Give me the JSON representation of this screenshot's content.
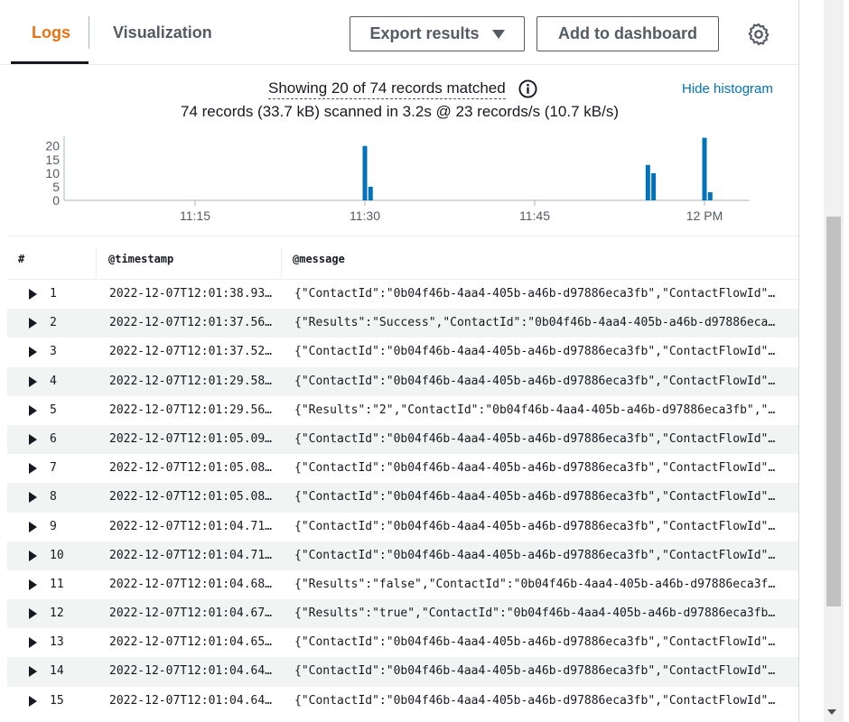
{
  "tabs": {
    "logs": "Logs",
    "visualization": "Visualization"
  },
  "toolbar": {
    "export_label": "Export results",
    "dashboard_label": "Add to dashboard"
  },
  "summary": {
    "matched": "Showing 20 of 74 records matched",
    "scanned": "74 records (33.7 kB) scanned in 3.2s @ 23 records/s (10.7 kB/s)",
    "hide_histogram": "Hide histogram"
  },
  "chart_data": {
    "type": "bar",
    "x_tick_labels": [
      "11:15",
      "11:30",
      "11:45",
      "12 PM"
    ],
    "y_tick_labels": [
      "20",
      "15",
      "10",
      "5",
      "0"
    ],
    "ylim": [
      0,
      22
    ],
    "bars": [
      {
        "x": "11:30",
        "value": 20
      },
      {
        "x": "11:30:30",
        "value": 5
      },
      {
        "x": "11:55",
        "value": 13
      },
      {
        "x": "11:55:30",
        "value": 10
      },
      {
        "x": "12:00",
        "value": 23
      },
      {
        "x": "12:00:30",
        "value": 3
      }
    ],
    "color": "#0073bb",
    "grid": false
  },
  "table": {
    "headers": [
      "#",
      "@timestamp",
      "@message"
    ],
    "rows": [
      {
        "n": "1",
        "ts": "2022-12-07T12:01:38.93…",
        "msg": "{\"ContactId\":\"0b04f46b-4aa4-405b-a46b-d97886eca3fb\",\"ContactFlowId\"…"
      },
      {
        "n": "2",
        "ts": "2022-12-07T12:01:37.56…",
        "msg": "{\"Results\":\"Success\",\"ContactId\":\"0b04f46b-4aa4-405b-a46b-d97886eca…"
      },
      {
        "n": "3",
        "ts": "2022-12-07T12:01:37.52…",
        "msg": "{\"ContactId\":\"0b04f46b-4aa4-405b-a46b-d97886eca3fb\",\"ContactFlowId\"…"
      },
      {
        "n": "4",
        "ts": "2022-12-07T12:01:29.58…",
        "msg": "{\"ContactId\":\"0b04f46b-4aa4-405b-a46b-d97886eca3fb\",\"ContactFlowId\"…"
      },
      {
        "n": "5",
        "ts": "2022-12-07T12:01:29.56…",
        "msg": "{\"Results\":\"2\",\"ContactId\":\"0b04f46b-4aa4-405b-a46b-d97886eca3fb\",\"…"
      },
      {
        "n": "6",
        "ts": "2022-12-07T12:01:05.09…",
        "msg": "{\"ContactId\":\"0b04f46b-4aa4-405b-a46b-d97886eca3fb\",\"ContactFlowId\"…"
      },
      {
        "n": "7",
        "ts": "2022-12-07T12:01:05.08…",
        "msg": "{\"ContactId\":\"0b04f46b-4aa4-405b-a46b-d97886eca3fb\",\"ContactFlowId\"…"
      },
      {
        "n": "8",
        "ts": "2022-12-07T12:01:05.08…",
        "msg": "{\"ContactId\":\"0b04f46b-4aa4-405b-a46b-d97886eca3fb\",\"ContactFlowId\"…"
      },
      {
        "n": "9",
        "ts": "2022-12-07T12:01:04.71…",
        "msg": "{\"ContactId\":\"0b04f46b-4aa4-405b-a46b-d97886eca3fb\",\"ContactFlowId\"…"
      },
      {
        "n": "10",
        "ts": "2022-12-07T12:01:04.71…",
        "msg": "{\"ContactId\":\"0b04f46b-4aa4-405b-a46b-d97886eca3fb\",\"ContactFlowId\"…"
      },
      {
        "n": "11",
        "ts": "2022-12-07T12:01:04.68…",
        "msg": "{\"Results\":\"false\",\"ContactId\":\"0b04f46b-4aa4-405b-a46b-d97886eca3f…"
      },
      {
        "n": "12",
        "ts": "2022-12-07T12:01:04.67…",
        "msg": "{\"Results\":\"true\",\"ContactId\":\"0b04f46b-4aa4-405b-a46b-d97886eca3fb…"
      },
      {
        "n": "13",
        "ts": "2022-12-07T12:01:04.65…",
        "msg": "{\"ContactId\":\"0b04f46b-4aa4-405b-a46b-d97886eca3fb\",\"ContactFlowId\"…"
      },
      {
        "n": "14",
        "ts": "2022-12-07T12:01:04.64…",
        "msg": "{\"ContactId\":\"0b04f46b-4aa4-405b-a46b-d97886eca3fb\",\"ContactFlowId\"…"
      },
      {
        "n": "15",
        "ts": "2022-12-07T12:01:04.64…",
        "msg": "{\"ContactId\":\"0b04f46b-4aa4-405b-a46b-d97886eca3fb\",\"ContactFlowId\"…"
      }
    ]
  },
  "icons": {
    "settings": "gear-icon",
    "info": "info-icon",
    "expand": "caret-right-icon"
  },
  "colors": {
    "accent": "#ec7211",
    "link": "#0073bb",
    "bar": "#0073bb"
  }
}
